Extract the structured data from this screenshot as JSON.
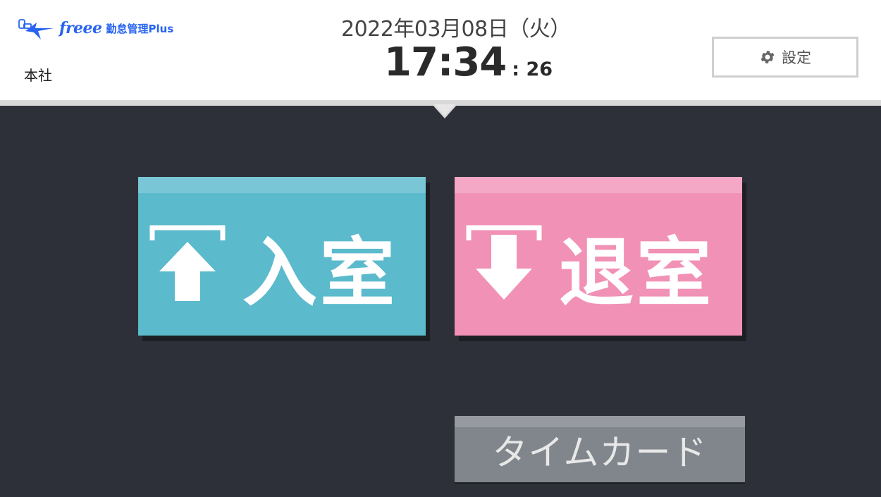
{
  "header": {
    "brand_name": "freee",
    "product_name": "勤怠管理Plus",
    "office": "本社",
    "date": "2022年03月08日（火）",
    "time_hm": "17:34",
    "time_sec": ": 26",
    "settings_label": "設定",
    "brand_color": "#2864f0"
  },
  "actions": {
    "enter": {
      "label": "入室",
      "icon": "enter-arrow-up-icon",
      "color": "#5bbacc"
    },
    "exit": {
      "label": "退室",
      "icon": "exit-arrow-down-icon",
      "color": "#f191b5"
    },
    "timecard": {
      "label": "タイムカード",
      "color": "#81868c"
    }
  }
}
